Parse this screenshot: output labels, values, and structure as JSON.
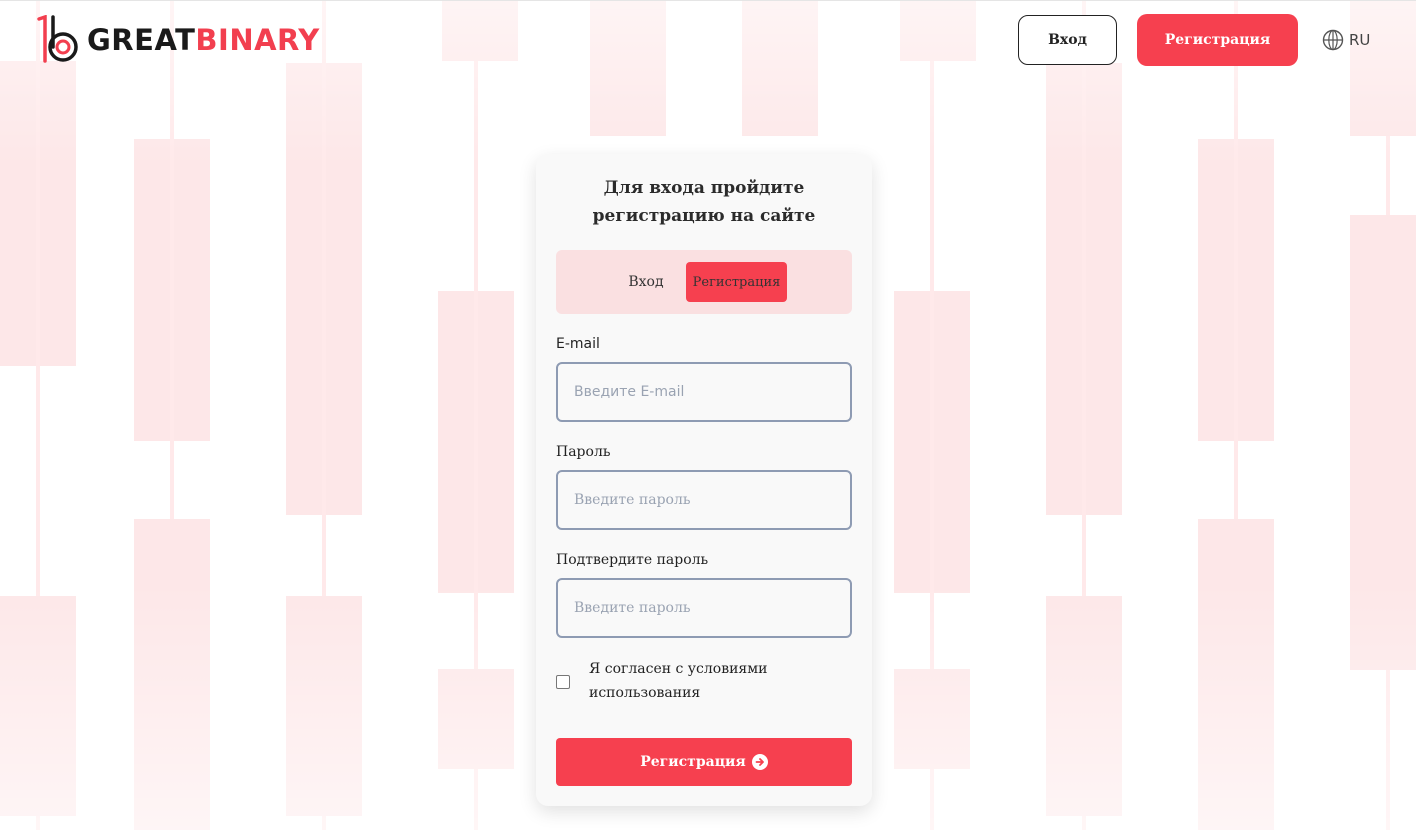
{
  "brand": {
    "name_part1": "GREAT",
    "name_part2": "BINARY",
    "accent_color": "#f6404f"
  },
  "header": {
    "login_label": "Вход",
    "register_label": "Регистрация",
    "language": "RU",
    "language_icon": "globe-icon"
  },
  "form": {
    "title_line1": "Для входа пройдите",
    "title_line2": "регистрацию на сайте",
    "tabs": [
      {
        "label": "Вход",
        "active": false
      },
      {
        "label": "Регистрация",
        "active": true
      }
    ],
    "email": {
      "label": "E-mail",
      "placeholder": "Введите E-mail",
      "value": ""
    },
    "password": {
      "label": "Пароль",
      "placeholder": "Введите пароль",
      "value": ""
    },
    "confirm": {
      "label": "Подтвердите пароль",
      "placeholder": "Введите пароль",
      "value": ""
    },
    "agree": {
      "label": "Я согласен с условиями использования",
      "checked": false
    },
    "submit_label": "Регистрация",
    "submit_icon": "arrow-right-circle-icon"
  }
}
